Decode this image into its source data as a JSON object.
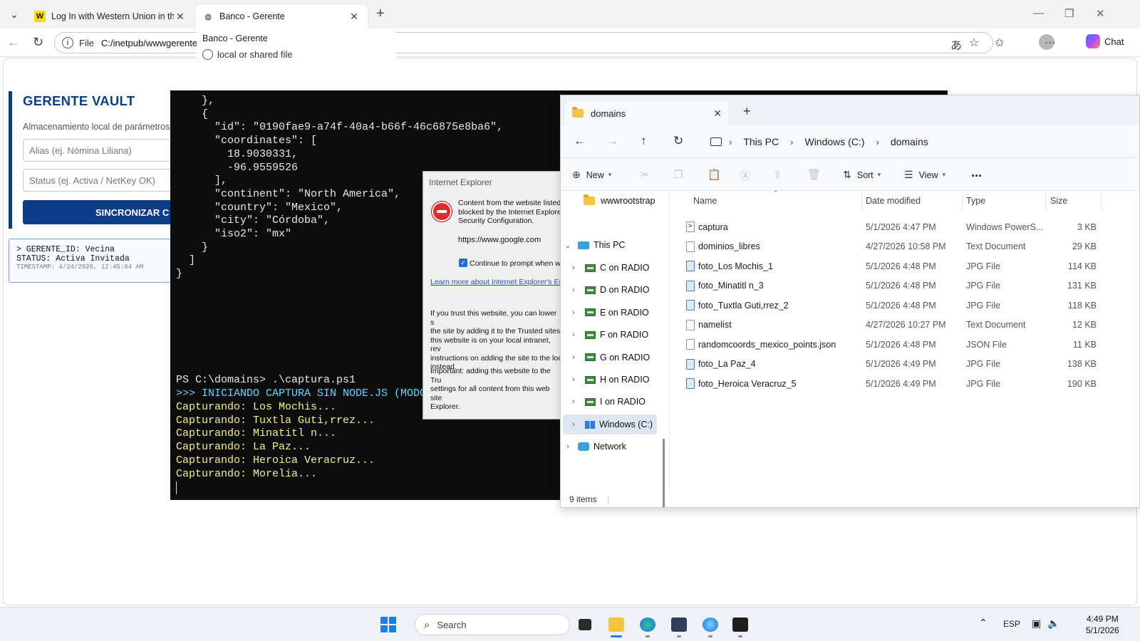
{
  "browser": {
    "tabs": [
      {
        "title": "Log In with Western Union in the U",
        "favicon": "western-union-logo"
      },
      {
        "title": "Banco - Gerente",
        "favicon": "globe-icon",
        "active": true
      }
    ],
    "address": {
      "scheme": "File",
      "url": "C:/inetpub/wwwgerente"
    },
    "tooltip": {
      "title": "Banco - Gerente",
      "subtitle": "local or shared file"
    },
    "chat_label": "Chat"
  },
  "vault": {
    "title": "GERENTE VAULT",
    "subtitle": "Almacenamiento local de parámetros",
    "alias_placeholder": "Alias (ej. Nómina Liliana)",
    "status_placeholder": "Status (ej. Activa / NetKey OK)",
    "sync_label": "SINCRONIZAR C",
    "record": {
      "id_line": "> GERENTE_ID: Vecina",
      "status_line": "STATUS: Activa Invitada",
      "timestamp_line": "TIMESTAMP: 4/24/2026, 12:45:04 AM"
    }
  },
  "terminal": {
    "json_lines": [
      "    },",
      "    {",
      "      \"id\": \"0190fae9-a74f-40a4-b66f-46c6875e8ba6\",",
      "      \"coordinates\": [",
      "        18.9030331,",
      "        -96.9559526",
      "      ],",
      "      \"continent\": \"North America\",",
      "      \"country\": \"Mexico\",",
      "      \"city\": \"Córdoba\",",
      "      \"iso2\": \"mx\"",
      "    }",
      "  ]",
      "}"
    ],
    "prompt": "PS C:\\domains> .\\captura.ps1",
    "banner": ">>> INICIANDO CAPTURA SIN NODE.JS (MODO",
    "capture_lines": [
      "Capturando: Los Mochis...",
      "Capturando: Tuxtla Guti,rrez...",
      "Capturando: Minatitl n...",
      "Capturando: La Paz...",
      "Capturando: Heroica Veracruz...",
      "Capturando: Morelia..."
    ]
  },
  "ie_dialog": {
    "title": "Internet Explorer",
    "message_lines": [
      "Content from the website listed",
      "blocked by the Internet Explore",
      "Security Configuration."
    ],
    "site": "https://www.google.com",
    "checkbox_label": "Continue to prompt when we",
    "link": "Learn more about Internet Explorer's En",
    "para1_lines": [
      "If you trust this website, you can lower s",
      "the site by adding it to the Trusted sites",
      "this website is on your local intranet, rev",
      "instructions on adding the site to the loc",
      "instead."
    ],
    "para2_lines": [
      "Important: adding this website to the Tru",
      "settings for all content from this web site",
      "Explorer."
    ]
  },
  "explorer": {
    "tab_title": "domains",
    "breadcrumb": [
      "This PC",
      "Windows (C:)",
      "domains"
    ],
    "commands": {
      "new": "New",
      "sort": "Sort",
      "view": "View",
      "more": "..."
    },
    "nav": {
      "pinned": "wwwrootstrap",
      "this_pc": "This PC",
      "drives": [
        "C on RADIO",
        "D on RADIO",
        "E on RADIO",
        "F on RADIO",
        "G on RADIO",
        "H on RADIO",
        "I on RADIO"
      ],
      "windows_drive": "Windows (C:)",
      "network": "Network"
    },
    "columns": {
      "name": "Name",
      "date": "Date modified",
      "type": "Type",
      "size": "Size"
    },
    "files": [
      {
        "name": "captura",
        "date": "5/1/2026 4:47 PM",
        "type": "Windows PowerS...",
        "size": "3 KB",
        "icon": "ps"
      },
      {
        "name": "dominios_libres",
        "date": "4/27/2026 10:58 PM",
        "type": "Text Document",
        "size": "29 KB",
        "icon": "txt"
      },
      {
        "name": "foto_Los Mochis_1",
        "date": "5/1/2026 4:48 PM",
        "type": "JPG File",
        "size": "114 KB",
        "icon": "jpg"
      },
      {
        "name": "foto_Minatitl n_3",
        "date": "5/1/2026 4:48 PM",
        "type": "JPG File",
        "size": "131 KB",
        "icon": "jpg"
      },
      {
        "name": "foto_Tuxtla Guti,rrez_2",
        "date": "5/1/2026 4:48 PM",
        "type": "JPG File",
        "size": "118 KB",
        "icon": "jpg"
      },
      {
        "name": "namelist",
        "date": "4/27/2026 10:27 PM",
        "type": "Text Document",
        "size": "12 KB",
        "icon": "txt"
      },
      {
        "name": "randomcoords_mexico_points.json",
        "date": "5/1/2026 4:48 PM",
        "type": "JSON File",
        "size": "11 KB",
        "icon": "txt"
      },
      {
        "name": "foto_La Paz_4",
        "date": "5/1/2026 4:49 PM",
        "type": "JPG File",
        "size": "138 KB",
        "icon": "jpg"
      },
      {
        "name": "foto_Heroica Veracruz_5",
        "date": "5/1/2026 4:49 PM",
        "type": "JPG File",
        "size": "190 KB",
        "icon": "jpg"
      }
    ],
    "status": "9 items"
  },
  "taskbar": {
    "search_placeholder": "Search",
    "language": "ESP",
    "time": "4:49 PM",
    "date": "5/1/2026"
  }
}
